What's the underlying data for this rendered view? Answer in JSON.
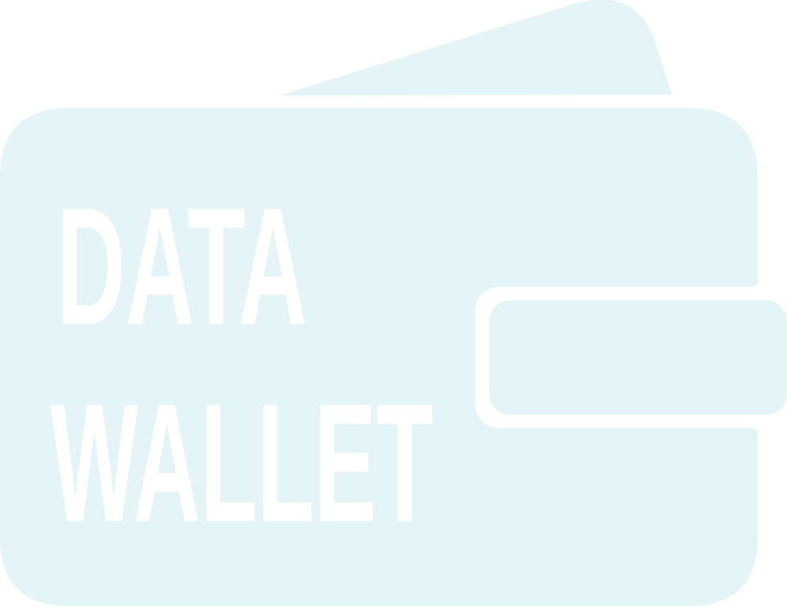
{
  "logo": {
    "line1": "DATA",
    "line2": "WALLET"
  },
  "colors": {
    "wallet_fill": "#E4F4F7",
    "text": "#FFFFFF",
    "background": "#FFFFFF"
  },
  "icons": {
    "main": "wallet-icon"
  }
}
